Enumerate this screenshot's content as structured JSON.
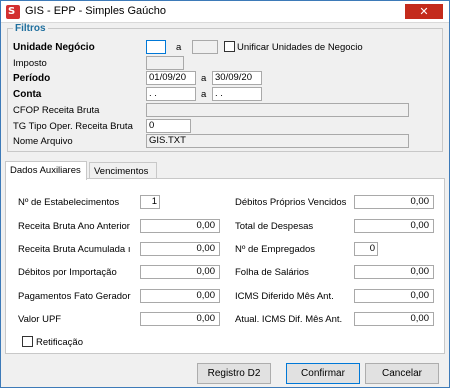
{
  "window": {
    "title": "GIS - EPP - Simples Gaúcho",
    "app_icon_glyph": "S",
    "close_glyph": "✕"
  },
  "filtros": {
    "legend": "Filtros",
    "unidade_negocio": {
      "label": "Unidade Negócio",
      "from": "",
      "sep": "a",
      "to": ""
    },
    "unificar": {
      "label": "Unificar Unidades de Negocio",
      "checked": false
    },
    "imposto": {
      "label": "Imposto",
      "value": ""
    },
    "periodo": {
      "label": "Período",
      "from": "01/09/20",
      "sep": "a",
      "to": "30/09/20"
    },
    "conta": {
      "label": "Conta",
      "from": " .  .",
      "sep": "a",
      "to": " .  ."
    },
    "cfop": {
      "label": "CFOP Receita Bruta",
      "value": ""
    },
    "tg_tipo": {
      "label": "TG Tipo Oper. Receita Bruta",
      "value": "0"
    },
    "nome_arquivo": {
      "label": "Nome Arquivo",
      "value": "GIS.TXT"
    }
  },
  "tabs": [
    {
      "label": "Dados Auxiliares",
      "active": true
    },
    {
      "label": "Vencimentos",
      "active": false
    }
  ],
  "dados": {
    "estabelecimentos": {
      "label": "Nº de Estabelecimentos",
      "value": "1"
    },
    "receita_ano": {
      "label": "Receita Bruta Ano Anterior",
      "value": "0,00"
    },
    "receita_acum": {
      "label": "Receita Bruta Acumulada ı",
      "value": "0,00"
    },
    "debitos_import": {
      "label": "Débitos por Importação",
      "value": "0,00"
    },
    "pagamentos": {
      "label": "Pagamentos Fato Gerador",
      "value": "0,00"
    },
    "valor_upf": {
      "label": "Valor UPF",
      "value": "0,00"
    },
    "debitos_proprios": {
      "label": "Débitos Próprios Vencidos",
      "value": "0,00"
    },
    "total_despesas": {
      "label": "Total de Despesas",
      "value": "0,00"
    },
    "empregados": {
      "label": "Nº de Empregados",
      "value": "0"
    },
    "folha_salarios": {
      "label": "Folha de Salários",
      "value": "0,00"
    },
    "icms_diferido": {
      "label": "ICMS Diferido Mês Ant.",
      "value": "0,00"
    },
    "atual_icms": {
      "label": "Atual. ICMS Dif. Mês Ant.",
      "value": "0,00"
    },
    "retificacao": {
      "label": "Retificação",
      "checked": false
    }
  },
  "buttons": {
    "registro_d2": "Registro D2",
    "confirmar": "Confirmar",
    "cancelar": "Cancelar"
  }
}
